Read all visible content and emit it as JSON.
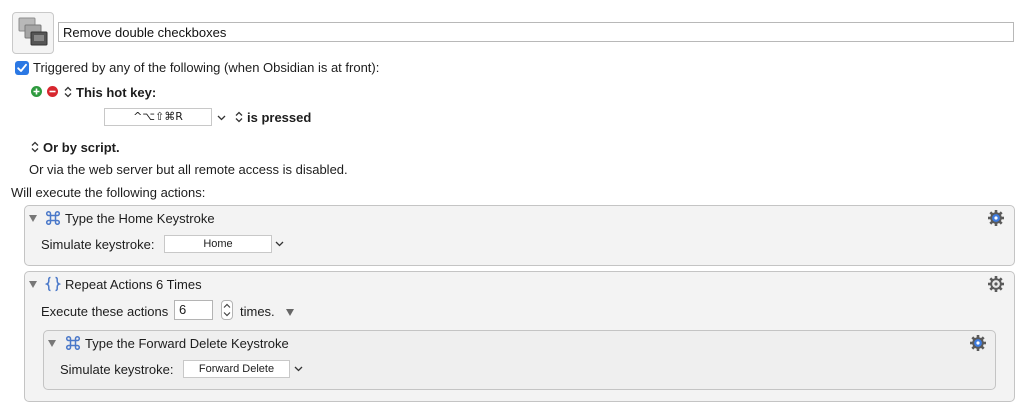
{
  "macro": {
    "name": "Remove double checkboxes",
    "icon": "keyboard-maestro-macro-icon"
  },
  "trigger": {
    "checked": true,
    "label": "Triggered by any of the following (when Obsidian is at front):",
    "hotkey_label": "This hot key:",
    "hotkey_value": "^⌥⇧⌘R",
    "pressed_label": "is pressed",
    "script_label": "Or by script.",
    "web_label": "Or via the web server but all remote access is disabled."
  },
  "actions_header": "Will execute the following actions:",
  "actions": [
    {
      "title": "Type the Home Keystroke",
      "field_label": "Simulate keystroke:",
      "field_value": "Home"
    },
    {
      "title": "Repeat Actions 6 Times",
      "execute_label": "Execute these actions",
      "count": "6",
      "times_label": "times.",
      "children": [
        {
          "title": "Type the Forward Delete Keystroke",
          "field_label": "Simulate keystroke:",
          "field_value": "Forward Delete"
        }
      ]
    }
  ],
  "colors": {
    "accent": "#2b78e4",
    "add_green": "#2e9a3e",
    "remove_red": "#d7262e",
    "icon_blue": "#4a78c9"
  }
}
